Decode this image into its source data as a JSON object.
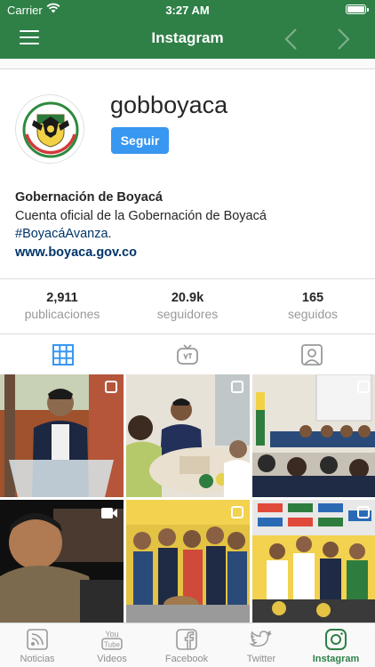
{
  "status_bar": {
    "carrier": "Carrier",
    "time": "3:27 AM"
  },
  "nav": {
    "title": "Instagram"
  },
  "profile": {
    "username": "gobboyaca",
    "follow_label": "Seguir",
    "full_name": "Gobernación de Boyacá",
    "description": "Cuenta oficial de la Gobernación de Boyacá",
    "hashtag": "#BoyacáAvanza",
    "hashtag_suffix": ".",
    "website": "www.boyaca.gov.co"
  },
  "stats": [
    {
      "value": "2,911",
      "label": "publicaciones"
    },
    {
      "value": "20.9k",
      "label": "seguidores"
    },
    {
      "value": "165",
      "label": "seguidos"
    }
  ],
  "tabs": [
    {
      "icon": "grid-icon",
      "active": true
    },
    {
      "icon": "igtv-icon",
      "active": false
    },
    {
      "icon": "tagged-icon",
      "active": false
    }
  ],
  "posts": [
    {
      "subject": "speaker at podium",
      "type": "carousel"
    },
    {
      "subject": "meeting at table",
      "type": "carousel"
    },
    {
      "subject": "conference panel",
      "type": "carousel"
    },
    {
      "subject": "cyclist portrait",
      "type": "video"
    },
    {
      "subject": "group photo",
      "type": "carousel"
    },
    {
      "subject": "cycling podium",
      "type": "carousel"
    }
  ],
  "bottom_tabs": [
    {
      "label": "Noticias",
      "icon": "news-icon",
      "active": false
    },
    {
      "label": "Videos",
      "icon": "youtube-icon",
      "active": false
    },
    {
      "label": "Facebook",
      "icon": "facebook-icon",
      "active": false
    },
    {
      "label": "Twitter",
      "icon": "twitter-icon",
      "active": false
    },
    {
      "label": "Instagram",
      "icon": "instagram-icon",
      "active": true
    }
  ],
  "colors": {
    "brand_green": "#2e8047",
    "follow_blue": "#3897f0",
    "link_blue": "#003569",
    "muted": "#999999"
  }
}
